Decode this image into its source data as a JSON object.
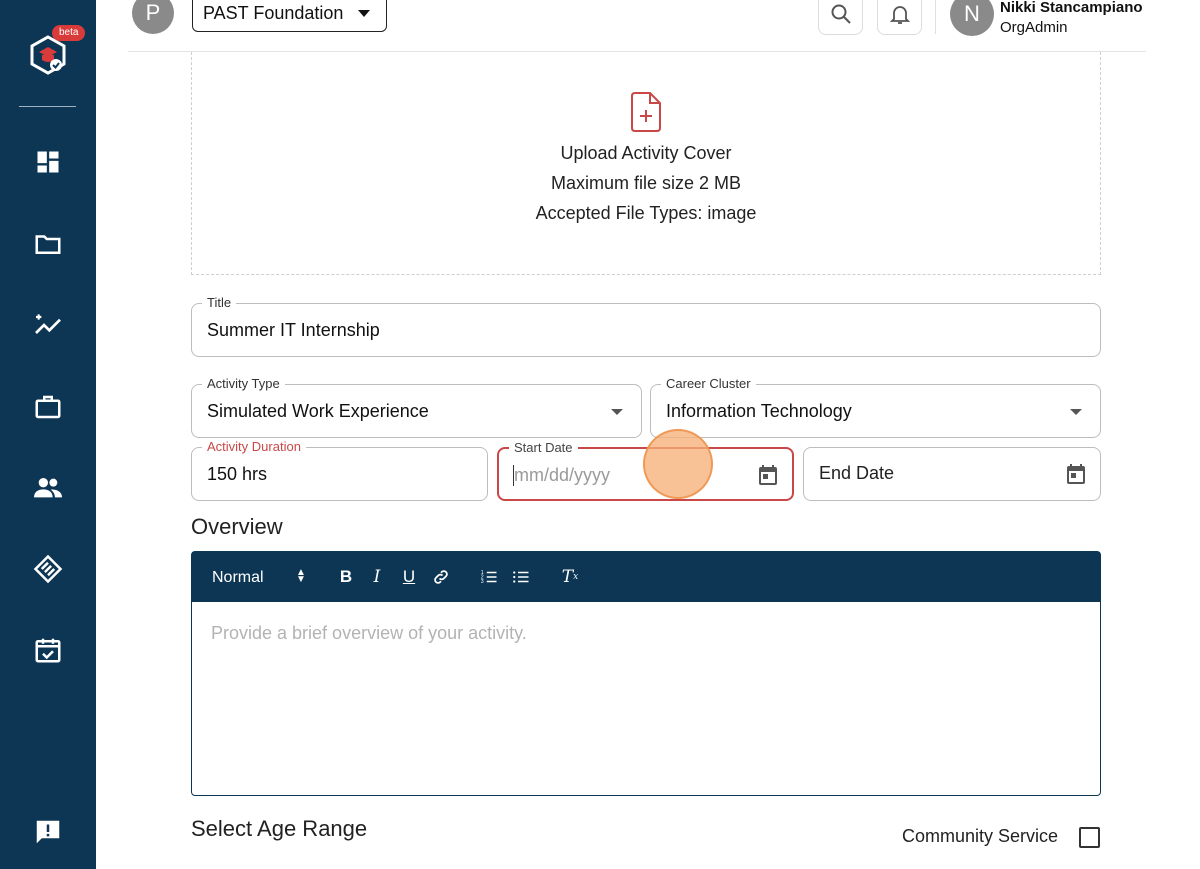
{
  "sidebar": {
    "beta_badge": "beta",
    "items": [
      {
        "icon": "dashboard-icon"
      },
      {
        "icon": "folder-icon"
      },
      {
        "icon": "analytics-icon"
      },
      {
        "icon": "briefcase-icon"
      },
      {
        "icon": "people-icon"
      },
      {
        "icon": "handshake-icon"
      },
      {
        "icon": "calendar-check-icon"
      },
      {
        "icon": "feedback-icon"
      }
    ]
  },
  "header": {
    "org_initial": "P",
    "org_name": "PAST Foundation",
    "user_initial": "N",
    "user_name": "Nikki Stancampiano",
    "user_role": "OrgAdmin"
  },
  "upload": {
    "title": "Upload Activity Cover",
    "max_size": "Maximum file size 2 MB",
    "accepted": "Accepted File Types: image"
  },
  "form": {
    "title": {
      "label": "Title",
      "value": "Summer IT Internship"
    },
    "activity_type": {
      "label": "Activity Type",
      "value": "Simulated Work Experience"
    },
    "career_cluster": {
      "label": "Career Cluster",
      "value": "Information Technology"
    },
    "duration": {
      "label": "Activity Duration",
      "value": "150 hrs"
    },
    "start_date": {
      "label": "Start Date",
      "placeholder": "mm/dd/yyyy"
    },
    "end_date": {
      "placeholder": "End Date"
    }
  },
  "overview": {
    "title": "Overview",
    "format_select": "Normal",
    "placeholder": "Provide a brief overview of your activity."
  },
  "age_range": {
    "title": "Select Age Range"
  },
  "community_service": {
    "label": "Community Service",
    "checked": false
  },
  "colors": {
    "sidebar_bg": "#0c3654",
    "accent_red": "#c94747",
    "click_indicator": "#f6b078"
  }
}
